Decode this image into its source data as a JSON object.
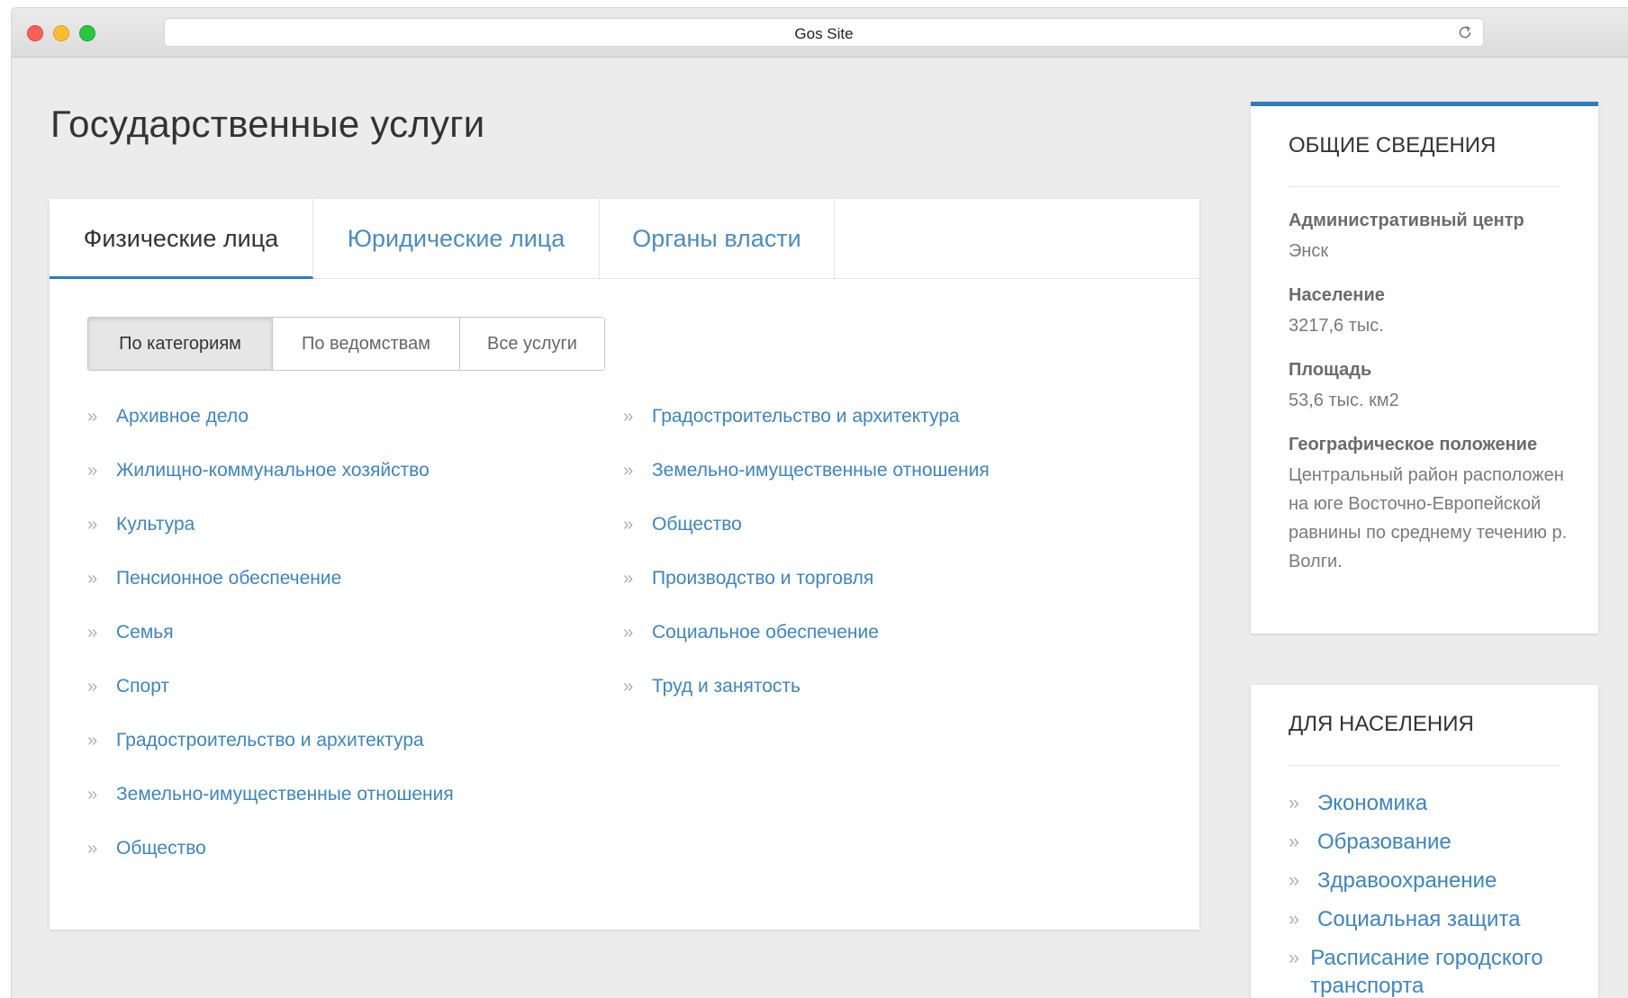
{
  "browser": {
    "title": "Gos Site"
  },
  "page": {
    "title": "Государственные услуги"
  },
  "tabs": [
    {
      "label": "Физические лица",
      "active": true
    },
    {
      "label": "Юридические лица",
      "active": false
    },
    {
      "label": "Органы власти",
      "active": false
    }
  ],
  "filters": [
    {
      "label": "По категориям",
      "active": true
    },
    {
      "label": "По ведомствам",
      "active": false
    },
    {
      "label": "Все услуги",
      "active": false
    }
  ],
  "categories_left": [
    "Архивное дело",
    "Жилищно-коммунальное хозяйство",
    "Культура",
    "Пенсионное обеспечение",
    "Семья",
    "Спорт",
    "Градостроительство и архитектура",
    "Земельно-имущественные отношения",
    "Общество"
  ],
  "categories_right": [
    "Градостроительство и архитектура",
    "Земельно-имущественные отношения",
    "Общество",
    "Производство и торговля",
    "Социальное обеспечение",
    "Труд и занятость"
  ],
  "info": {
    "title": "ОБЩИЕ СВЕДЕНИЯ",
    "items": [
      {
        "label": "Административный центр",
        "value": "Энск"
      },
      {
        "label": "Население",
        "value": "3217,6 тыс."
      },
      {
        "label": "Площадь",
        "value": "53,6 тыс. км2"
      },
      {
        "label": "Географическое положение",
        "value": "Центральный район расположен на юге Восточно-Европейской равнины по среднему течению р. Волги."
      }
    ]
  },
  "population": {
    "title": "ДЛЯ НАСЕЛЕНИЯ",
    "items": [
      "Экономика",
      "Образование",
      "Здравоохранение",
      "Социальная защита",
      "Расписание городского транспорта"
    ]
  },
  "icons": {
    "list_marker": "double-chevron-right-icon",
    "reload": "reload-icon"
  },
  "colors": {
    "accent": "#2f7cc0",
    "link": "#3c85c4"
  }
}
